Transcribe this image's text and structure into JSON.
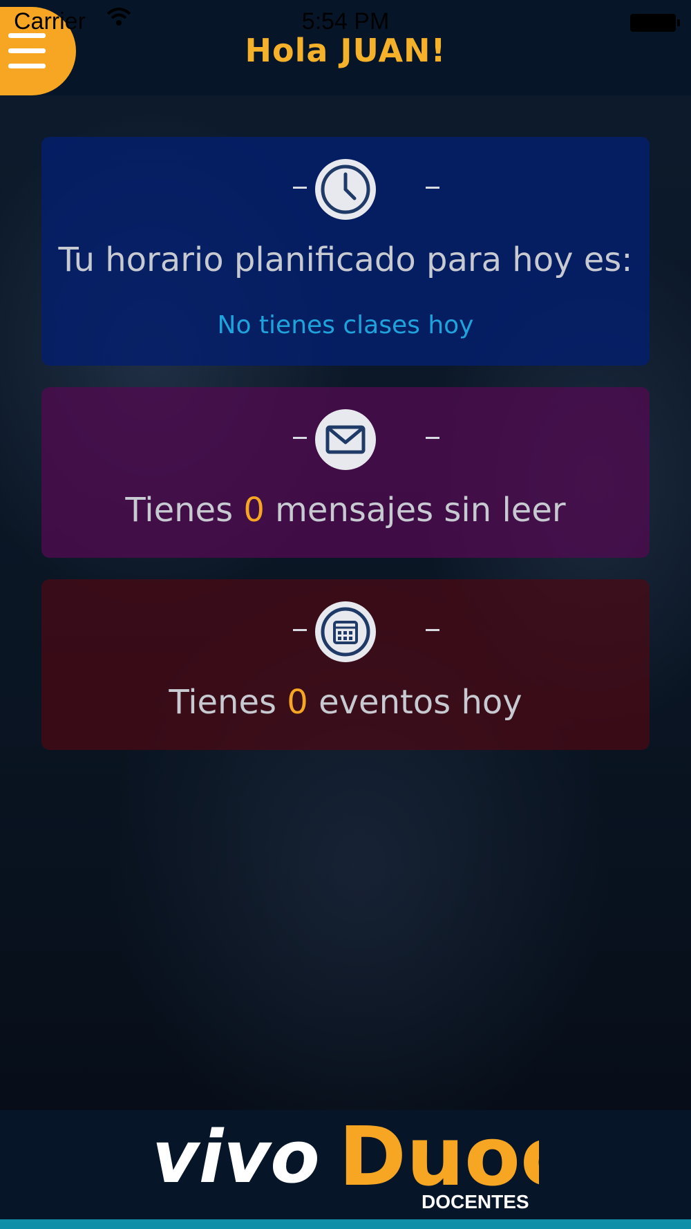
{
  "status_bar": {
    "carrier": "Carrier",
    "time": "5:54 PM"
  },
  "header": {
    "title": "Hola JUAN!",
    "menu_icon": "hamburger-menu-icon"
  },
  "cards": {
    "schedule": {
      "icon": "clock-icon",
      "text": "Tu horario planificado para hoy es:",
      "subtext": "No tienes clases hoy"
    },
    "messages": {
      "icon": "envelope-icon",
      "prefix": "Tienes",
      "count": "0",
      "suffix": "mensajes sin leer"
    },
    "events": {
      "icon": "calendar-icon",
      "prefix": "Tienes",
      "count": "0",
      "suffix": "eventos hoy"
    }
  },
  "footer": {
    "logo_text_part1": "vivo",
    "logo_text_part2": "Duoc",
    "logo_subtext": "DOCENTES",
    "colors": {
      "accent": "#f6a623",
      "nav": "#061628",
      "link": "#1ea4dc"
    }
  }
}
